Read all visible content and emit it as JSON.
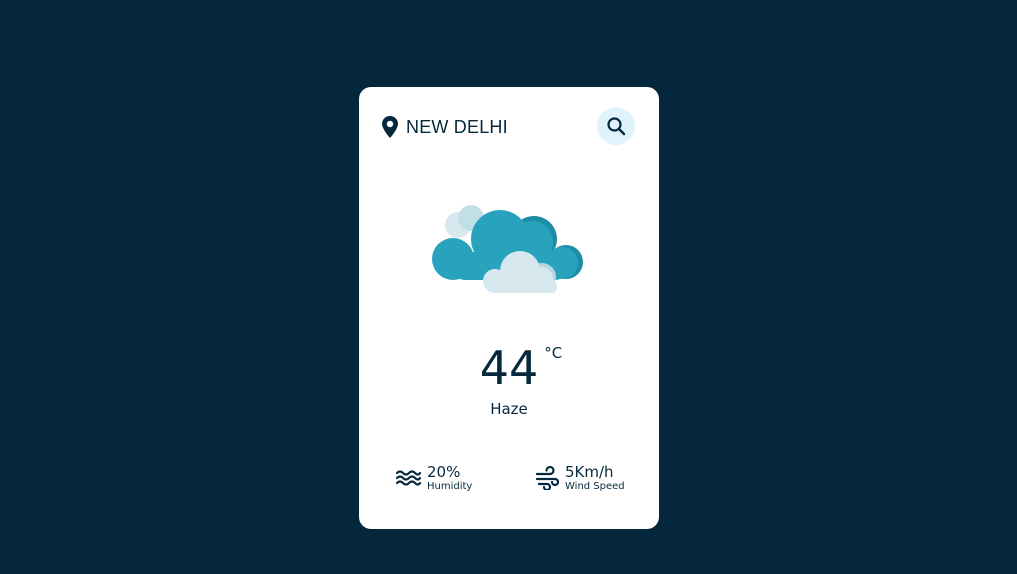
{
  "location": {
    "icon": "map-pin-icon",
    "city": "NEW DELHI"
  },
  "search": {
    "icon": "search-icon"
  },
  "weather": {
    "icon": "cloud-icon",
    "temperature": "44",
    "unit": "°C",
    "description": "Haze"
  },
  "details": {
    "humidity": {
      "icon": "waves-icon",
      "value": "20%",
      "label": "Humidity"
    },
    "wind": {
      "icon": "wind-icon",
      "value": "5Km/h",
      "label": "Wind Speed"
    }
  },
  "colors": {
    "background": "#04273b",
    "card": "#ffffff",
    "text": "#06283d",
    "search_bg": "#e0f2fb",
    "cloud_main": "#29a3bd",
    "cloud_light": "#d7e9ef"
  }
}
